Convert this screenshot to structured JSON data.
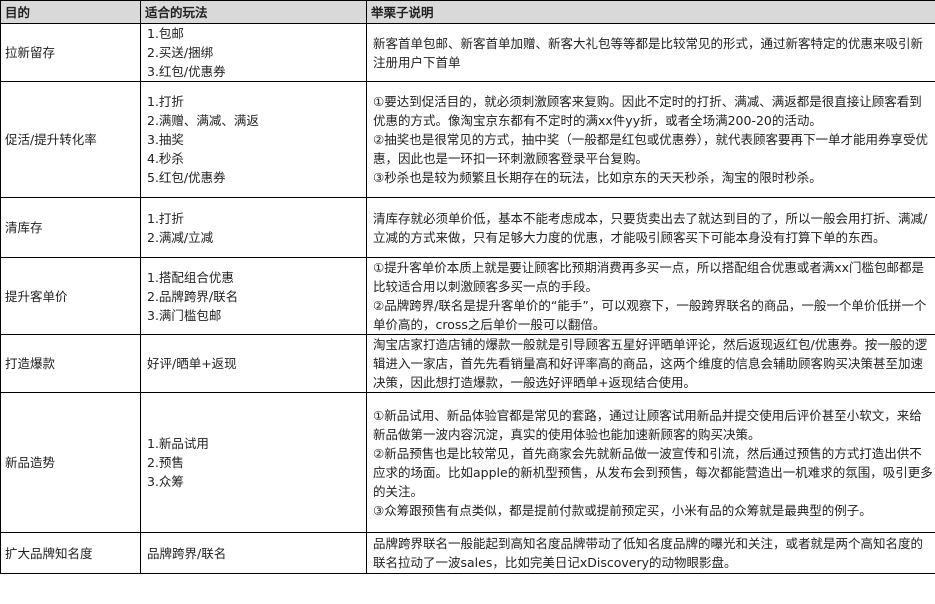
{
  "headers": [
    "目的",
    "适合的玩法",
    "举栗子说明"
  ],
  "rows": [
    {
      "goal": "拉新留存",
      "methods": [
        "1.包邮",
        "2.买送/捆绑",
        "3.红包/优惠券"
      ],
      "desc": [
        "新客首单包邮、新客首单加赠、新客大礼包等等都是比较常见的形式，通过新客特定的优惠来吸引新注册用户下首单"
      ]
    },
    {
      "goal": "促活/提升转化率",
      "methods": [
        "1.打折",
        "2.满赠、满减、满返",
        "3.抽奖",
        "4.秒杀",
        "5.红包/优惠券"
      ],
      "desc": [
        "①要达到促活目的，就必须刺激顾客来复购。因此不定时的打折、满减、满返都是很直接让顾客看到优惠的方式。像淘宝京东都有不定时的满xx件yy折，或者全场满200-20的活动。",
        "②抽奖也是很常见的方式，抽中奖（一般都是红包或优惠券），就代表顾客要再下一单才能用券享受优惠，因此也是一环扣一环刺激顾客登录平台复购。",
        "③秒杀也是较为频繁且长期存在的玩法，比如京东的天天秒杀，淘宝的限时秒杀。"
      ]
    },
    {
      "goal": "清库存",
      "methods": [
        "1.打折",
        "2.满减/立减"
      ],
      "desc": [
        "清库存就必须单价低，基本不能考虑成本，只要货卖出去了就达到目的了，所以一般会用打折、满减/立减的方式来做，只有足够大力度的优惠，才能吸引顾客买下可能本身没有打算下单的东西。"
      ]
    },
    {
      "goal": "提升客单价",
      "methods": [
        "1.搭配组合优惠",
        "2.品牌跨界/联名",
        "3.满门槛包邮"
      ],
      "desc": [
        "①提升客单价本质上就是要让顾客比预期消费再多买一点，所以搭配组合优惠或者满xx门槛包邮都是比较适合用以刺激顾客多买一点的手段。",
        "②品牌跨界/联名是提升客单价的“能手”，可以观察下，一般跨界联名的商品，一般一个单价低拼一个单价高的，cross之后单价一般可以翻倍。"
      ]
    },
    {
      "goal": "打造爆款",
      "methods": [
        "好评/晒单+返现"
      ],
      "desc": [
        "淘宝店家打造店铺的爆款一般就是引导顾客五星好评晒单评论，然后返现返红包/优惠券。按一般的逻辑进入一家店，首先先看销量高和好评率高的商品，这两个维度的信息会辅助顾客购买决策甚至加速决策，因此想打造爆款，一般选好评晒单+返现结合使用。"
      ]
    },
    {
      "goal": "新品造势",
      "methods": [
        "1.新品试用",
        "2.预售",
        "3.众筹"
      ],
      "desc": [
        "①新品试用、新品体验官都是常见的套路，通过让顾客试用新品并提交使用后评价甚至小软文，来给新品做第一波内容沉淀，真实的使用体验也能加速新顾客的购买决策。",
        "②新品预售也是比较常见，首先商家会先就新品做一波宣传和引流，然后通过预售的方式打造出供不应求的场面。比如apple的新机型预售，从发布会到预售，每次都能营造出一机难求的氛围，吸引更多的关注。",
        "③众筹跟预售有点类似，都是提前付款或提前预定买，小米有品的众筹就是最典型的例子。"
      ]
    },
    {
      "goal": "扩大品牌知名度",
      "methods": [
        "品牌跨界/联名"
      ],
      "desc": [
        "品牌跨界联名一般能起到高知名度品牌带动了低知名度品牌的曝光和关注，或者就是两个高知名度的联名拉动了一波sales，比如完美日记xDiscovery的动物眼影盘。"
      ]
    }
  ]
}
